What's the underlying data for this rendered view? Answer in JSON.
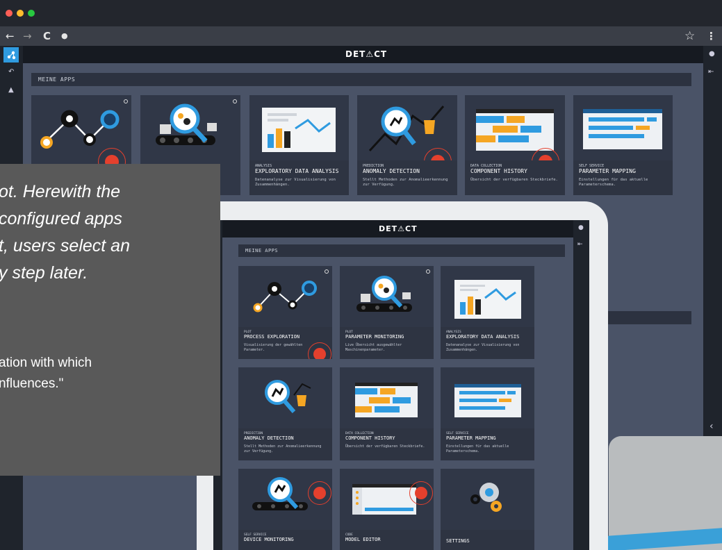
{
  "browser": {
    "back": "←",
    "forward": "→",
    "reload": "C",
    "lock": "🔒",
    "star": "☆",
    "menu": "⋮"
  },
  "app": {
    "brand": "DET⚠CT",
    "section_title": "MEINE APPS"
  },
  "background_tiles": [
    {
      "category": "",
      "title": "",
      "desc": ""
    },
    {
      "category": "",
      "title": "",
      "desc": ""
    },
    {
      "category": "ANALYSIS",
      "title": "EXPLORATORY DATA ANALYSIS",
      "desc": "Datenanalyse zur Visualisierung von Zusammenhängen."
    },
    {
      "category": "PREDICTION",
      "title": "ANOMALY DETECTION",
      "desc": "Stellt Methoden zur Anomalieerkennung zur Verfügung."
    },
    {
      "category": "DATA COLLECTION",
      "title": "COMPONENT HISTORY",
      "desc": "Übersicht der verfügbaren Steckbriefe."
    },
    {
      "category": "SELF SERVICE",
      "title": "PARAMETER MAPPING",
      "desc": "Einstellungen für das aktuelle Parameterschema."
    }
  ],
  "tablet_tiles": [
    {
      "category": "PLOT",
      "title": "PROCESS EXPLORATION",
      "desc": "Visualisierung der gewählten Parameter."
    },
    {
      "category": "PLOT",
      "title": "PARAMETER MONITORING",
      "desc": "Live Übersicht ausgewählter Maschinenparameter."
    },
    {
      "category": "ANALYSIS",
      "title": "EXPLORATORY DATA ANALYSIS",
      "desc": "Datenanalyse zur Visualisierung von Zusammenhängen."
    },
    {
      "category": "PREDICTION",
      "title": "ANOMALY DETECTION",
      "desc": "Stellt Methoden zur Anomalieerkennung zur Verfügung."
    },
    {
      "category": "DATA COLLECTION",
      "title": "COMPONENT HISTORY",
      "desc": "Übersicht der verfügbaren Steckbriefe."
    },
    {
      "category": "SELF SERVICE",
      "title": "PARAMETER MAPPING",
      "desc": "Einstellungen für das aktuelle Parameterschema."
    },
    {
      "category": "SELF SERVICE",
      "title": "DEVICE MONITORING",
      "desc": ""
    },
    {
      "category": "CODE",
      "title": "MODEL EDITOR",
      "desc": ""
    },
    {
      "category": "",
      "title": "SETTINGS",
      "desc": ""
    }
  ],
  "overlay": {
    "lines": [
      "ot. Herewith the",
      "configured apps",
      "t, users select an",
      "y step later.",
      "ation with which",
      "nfluences.\""
    ]
  },
  "colors": {
    "accent_red": "#e4402d",
    "accent_blue": "#2f9be0",
    "accent_orange": "#f5a623",
    "bg": "#4a5367"
  }
}
